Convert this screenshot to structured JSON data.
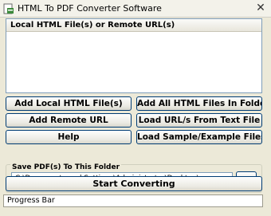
{
  "window": {
    "title": "HTML To PDF Converter Software",
    "close_glyph": "✕"
  },
  "list": {
    "header": "Local HTML File(s) or Remote URL(s)",
    "items": []
  },
  "buttons": {
    "add_local": "Add Local HTML File(s)",
    "add_all_folder": "Add All HTML Files In Folder",
    "add_remote": "Add Remote URL",
    "load_urls": "Load URL/s From Text File",
    "help": "Help",
    "load_sample": "Load Sample/Example Files",
    "start": "Start Converting"
  },
  "save_folder": {
    "label": "Save PDF(s) To This Folder",
    "value": "C:\\Documents and Settings\\Administrator\\Desktop\\",
    "browse_label": "..."
  },
  "progress": {
    "label": "Progress Bar"
  },
  "icons": {
    "app_icon": "pdf-app-icon",
    "close": "close-icon",
    "browse": "ellipsis"
  }
}
